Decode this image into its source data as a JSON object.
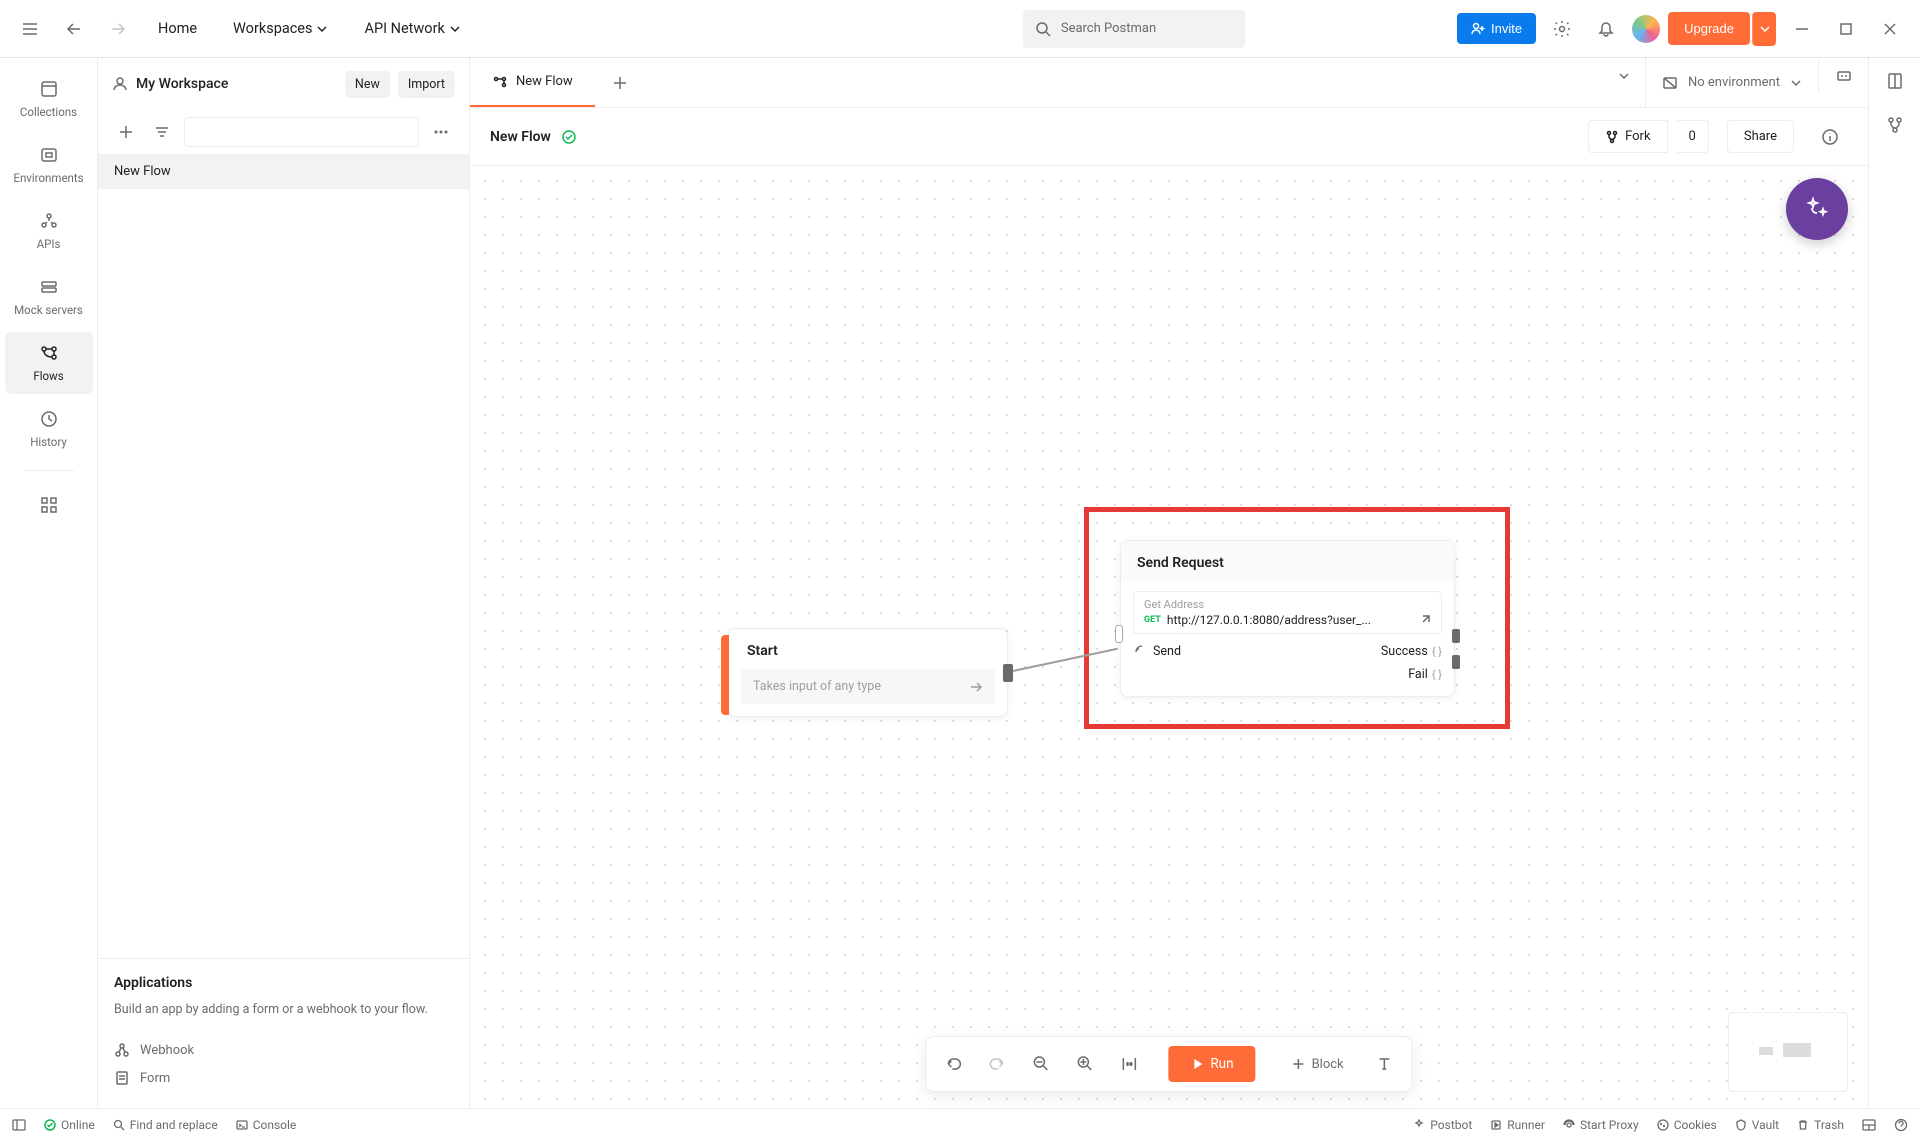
{
  "topbar": {
    "home": "Home",
    "workspaces": "Workspaces",
    "api_network": "API Network",
    "search_placeholder": "Search Postman",
    "invite": "Invite",
    "upgrade": "Upgrade"
  },
  "left_rail": {
    "items": [
      {
        "label": "Collections"
      },
      {
        "label": "Environments"
      },
      {
        "label": "APIs"
      },
      {
        "label": "Mock servers"
      },
      {
        "label": "Flows"
      },
      {
        "label": "History"
      }
    ]
  },
  "side": {
    "workspace": "My Workspace",
    "new": "New",
    "import": "Import",
    "list": [
      {
        "label": "New Flow"
      }
    ],
    "apps": {
      "title": "Applications",
      "desc": "Build an app by adding a form or a webhook to your flow.",
      "webhook": "Webhook",
      "form": "Form"
    }
  },
  "tabs": {
    "active": {
      "label": "New Flow"
    }
  },
  "env": {
    "label": "No environment"
  },
  "flow": {
    "name": "New Flow",
    "fork": "Fork",
    "fork_count": "0",
    "share": "Share"
  },
  "canvas": {
    "start": {
      "title": "Start",
      "placeholder": "Takes input of any type"
    },
    "request": {
      "title": "Send Request",
      "label": "Get Address",
      "method": "GET",
      "url": "http://127.0.0.1:8080/address?user_...",
      "send": "Send",
      "success": "Success",
      "fail": "Fail",
      "port": "{ }"
    },
    "toolbar": {
      "run": "Run",
      "block": "Block"
    }
  },
  "footer": {
    "online": "Online",
    "find": "Find and replace",
    "console": "Console",
    "postbot": "Postbot",
    "runner": "Runner",
    "proxy": "Start Proxy",
    "cookies": "Cookies",
    "vault": "Vault",
    "trash": "Trash"
  }
}
